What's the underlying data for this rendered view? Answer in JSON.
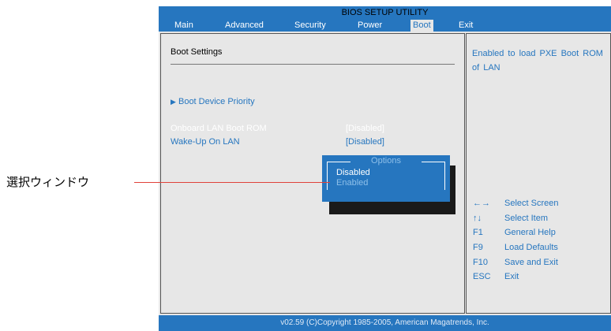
{
  "header": {
    "title": "BIOS SETUP UTILITY"
  },
  "menu": {
    "items": [
      {
        "label": "Main"
      },
      {
        "label": "Advanced"
      },
      {
        "label": "Security"
      },
      {
        "label": "Power"
      },
      {
        "label": "Boot"
      },
      {
        "label": "Exit"
      }
    ],
    "active": "Boot"
  },
  "main": {
    "section_title": "Boot Settings",
    "boot_device_priority": "Boot Device Priority",
    "settings": [
      {
        "label": "Onboard LAN Boot ROM",
        "value": "[Disabled]"
      },
      {
        "label": "Wake-Up On LAN",
        "value": "[Disabled]"
      }
    ]
  },
  "help": {
    "text": "Enabled to load PXE Boot ROM of LAN",
    "keys": [
      {
        "key": "←→",
        "desc": "Select Screen"
      },
      {
        "key": "↑↓",
        "desc": "Select Item"
      },
      {
        "key": "F1",
        "desc": "General Help"
      },
      {
        "key": "F9",
        "desc": "Load Defaults"
      },
      {
        "key": "F10",
        "desc": "Save and Exit"
      },
      {
        "key": "ESC",
        "desc": "Exit"
      }
    ]
  },
  "popup": {
    "title": "Options",
    "options": [
      "Disabled",
      "Enabled"
    ],
    "selected": "Disabled"
  },
  "annotation": {
    "label": "選択ウィンドウ"
  },
  "footer": {
    "text": "v02.59 (C)Copyright 1985-2005, American Magatrends, Inc."
  },
  "colors": {
    "accent": "#2676bf",
    "panel": "#e7e7e7",
    "annotation_line": "#e0423a"
  }
}
